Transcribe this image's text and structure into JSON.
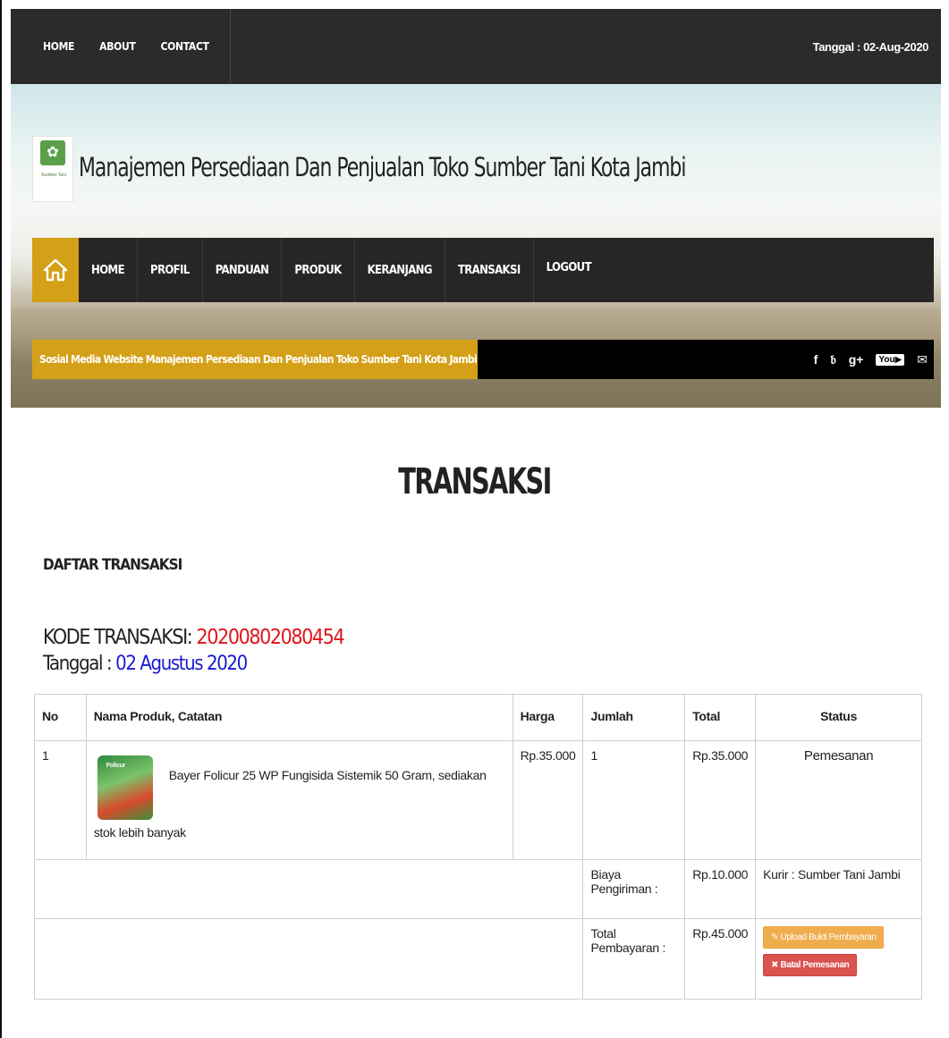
{
  "topbar": {
    "links": [
      "HOME",
      "ABOUT",
      "CONTACT"
    ],
    "date": "Tanggal : 02-Aug-2020"
  },
  "header": {
    "logo_text": "Sumber Tani",
    "site_title": "Manajemen Persediaan Dan Penjualan Toko Sumber Tani Kota Jambi",
    "nav": [
      "HOME",
      "PROFIL",
      "PANDUAN",
      "PRODUK",
      "KERANJANG",
      "TRANSAKSI",
      "LOGOUT"
    ],
    "social_label": "Sosial Media Website Manajemen Persediaan Dan Penjualan Toko Sumber Tani Kota Jambi",
    "social_icons": [
      "facebook-icon",
      "twitter-icon",
      "google-plus-icon",
      "youtube-icon",
      "mail-icon"
    ],
    "accent_color": "#d4a017"
  },
  "main": {
    "heading": "TRANSAKSI",
    "section_title": "DAFTAR TRANSAKSI",
    "kode_label": "KODE TRANSAKSI: ",
    "kode_value": "20200802080454",
    "tanggal_label": "Tanggal : ",
    "tanggal_value": "02 Agustus 2020"
  },
  "table": {
    "headers": [
      "No",
      "Nama Produk, Catatan",
      "Harga",
      "Jumlah",
      "Total",
      "Status"
    ],
    "row": {
      "no": "1",
      "product_name": "Bayer Folicur 25 WP Fungisida Sistemik 50 Gram, sediakan",
      "product_note_tail": "stok lebih banyak",
      "image_label": "Folicur",
      "harga": "Rp.35.000",
      "jumlah": "1",
      "total": "Rp.35.000",
      "status": "Pemesanan"
    },
    "shipping": {
      "label": "Biaya Pengiriman :",
      "value": "Rp.10.000",
      "courier": "Kurir : Sumber Tani Jambi"
    },
    "payment": {
      "label": "Total Pembayaran :",
      "value": "Rp.45.000",
      "upload_button": "Upload Bukti Pembayaran",
      "cancel_button": "Batal Pemesanan"
    }
  }
}
